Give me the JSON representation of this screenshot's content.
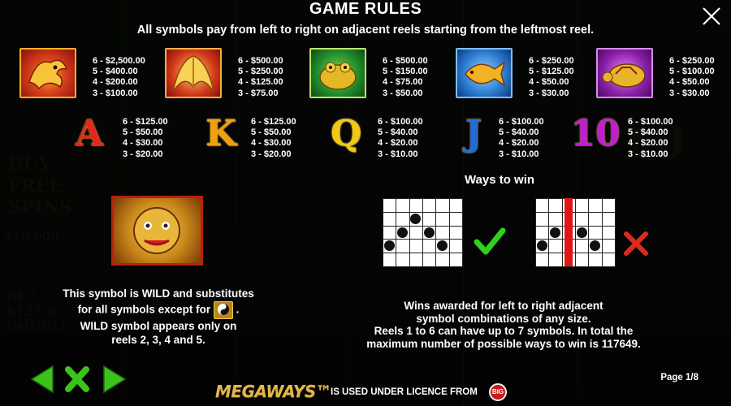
{
  "header": {
    "title": "GAME RULES",
    "subtitle": "All symbols pay from left to right on adjacent reels starting from the leftmost reel."
  },
  "high_symbols": [
    {
      "icon": "dragon-symbol-icon",
      "color": "#c8121b",
      "pays": [
        "6 - $2,500.00",
        "5 - $400.00",
        "4 - $200.00",
        "3 - $100.00"
      ]
    },
    {
      "icon": "phoenix-symbol-icon",
      "color": "#b8121a",
      "pays": [
        "6 - $500.00",
        "5 - $250.00",
        "4 - $125.00",
        "3 - $75.00"
      ]
    },
    {
      "icon": "frog-symbol-icon",
      "color": "#1f9a2c",
      "pays": [
        "6 - $500.00",
        "5 - $150.00",
        "4 - $75.00",
        "3 - $50.00"
      ]
    },
    {
      "icon": "koi-fish-symbol-icon",
      "color": "#1b6fd0",
      "pays": [
        "6 - $250.00",
        "5 - $125.00",
        "4 - $50.00",
        "3 - $30.00"
      ]
    },
    {
      "icon": "turtle-symbol-icon",
      "color": "#8b1fa8",
      "pays": [
        "6 - $250.00",
        "5 - $100.00",
        "4 - $50.00",
        "3 - $30.00"
      ]
    }
  ],
  "low_symbols": [
    {
      "label": "A",
      "color": "#e0281e",
      "pays": [
        "6 - $125.00",
        "5 - $50.00",
        "4 - $30.00",
        "3 - $20.00"
      ]
    },
    {
      "label": "K",
      "color": "#f0a010",
      "pays": [
        "6 - $125.00",
        "5 - $50.00",
        "4 - $30.00",
        "3 - $20.00"
      ]
    },
    {
      "label": "Q",
      "color": "#f2c814",
      "pays": [
        "6 - $100.00",
        "5 - $40.00",
        "4 - $20.00",
        "3 - $10.00"
      ]
    },
    {
      "label": "J",
      "color": "#1f6be0",
      "pays": [
        "6 - $100.00",
        "5 - $40.00",
        "4 - $20.00",
        "3 - $10.00"
      ]
    },
    {
      "label": "10",
      "color": "#c01fd0",
      "pays": [
        "6 - $100.00",
        "5 - $40.00",
        "4 - $20.00",
        "3 - $10.00"
      ]
    }
  ],
  "wild": {
    "icon": "foo-dog-wild-icon",
    "line1": "This symbol is WILD and substitutes",
    "line2": "for all symbols except for",
    "line2_end": ".",
    "line3": "WILD symbol appears only on",
    "line4": "reels 2, 3, 4 and 5.",
    "except_icon": "yin-yang-scatter-icon"
  },
  "ways": {
    "title": "Ways to win",
    "text": [
      "Wins awarded for left to right adjacent",
      "symbol combinations of any size.",
      "Reels 1 to 6 can have up to 7 symbols. In total the",
      "maximum number of possible ways to win is 117649."
    ]
  },
  "footer": {
    "page": "Page 1/8",
    "brand": "MEGAWAYS™",
    "licence": "IS USED UNDER LICENCE FROM",
    "badge": "BIG"
  },
  "colors": {
    "nav_green": "#3cc31a",
    "check_green": "#2fd11c",
    "cross_red": "#e02a1c",
    "gold": "#e3b64a"
  }
}
